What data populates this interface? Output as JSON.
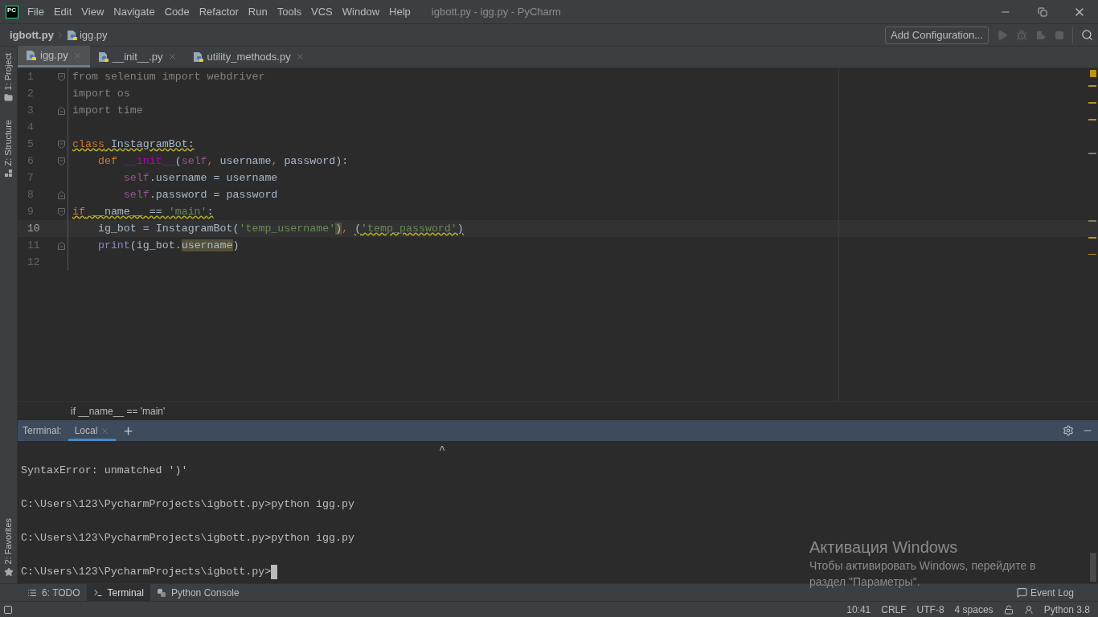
{
  "window": {
    "title": "igbott.py - igg.py - PyCharm",
    "logo": "PC"
  },
  "menu": [
    {
      "label": "File"
    },
    {
      "label": "Edit"
    },
    {
      "label": "View"
    },
    {
      "label": "Navigate"
    },
    {
      "label": "Code"
    },
    {
      "label": "Refactor"
    },
    {
      "label": "Run"
    },
    {
      "label": "Tools"
    },
    {
      "label": "VCS"
    },
    {
      "label": "Window"
    },
    {
      "label": "Help"
    }
  ],
  "breadcrumbs": [
    {
      "label": "igbott.py",
      "kind": "project"
    },
    {
      "label": "igg.py",
      "kind": "file"
    }
  ],
  "run_config": {
    "label": "Add Configuration..."
  },
  "side_tabs_top": [
    {
      "label": "1: Project",
      "kind": "folder"
    },
    {
      "label": "Z: Structure",
      "kind": "structure"
    }
  ],
  "side_tabs_bottom": [
    {
      "label": "2: Favorites",
      "kind": "star"
    }
  ],
  "editor_tabs": [
    {
      "label": "igg.py",
      "selected": true
    },
    {
      "label": "__init__.py",
      "selected": false
    },
    {
      "label": "utility_methods.py",
      "selected": false
    }
  ],
  "code_lines": [
    {
      "number": "1",
      "current": false,
      "fold_start": true,
      "fold_end": false,
      "tokens": [
        {
          "t": "from selenium import webdriver",
          "kind": "unused",
          "warning": false,
          "highlighted": false
        }
      ]
    },
    {
      "number": "2",
      "current": false,
      "fold_start": false,
      "fold_end": false,
      "tokens": [
        {
          "t": "import os",
          "kind": "unused",
          "warning": false,
          "highlighted": false
        }
      ]
    },
    {
      "number": "3",
      "current": false,
      "fold_start": false,
      "fold_end": true,
      "tokens": [
        {
          "t": "import time",
          "kind": "unused",
          "warning": false,
          "highlighted": false
        }
      ]
    },
    {
      "number": "4",
      "current": false,
      "fold_start": false,
      "fold_end": false
    },
    {
      "number": "5",
      "current": false,
      "fold_start": true,
      "fold_end": false,
      "tokens": [
        {
          "t": "class",
          "kind": "keyword",
          "warning": true,
          "highlighted": false
        },
        {
          "t": " InstagramBot:",
          "kind": "plain",
          "warning": true,
          "highlighted": false
        }
      ]
    },
    {
      "number": "6",
      "current": false,
      "fold_start": true,
      "fold_end": false,
      "tokens": [
        {
          "t": "    def ",
          "kind": "keyword",
          "warning": false,
          "highlighted": false
        },
        {
          "t": "__init__",
          "kind": "dunder",
          "warning": false,
          "highlighted": false
        },
        {
          "t": "(",
          "kind": "plain",
          "warning": false,
          "highlighted": false
        },
        {
          "t": "self",
          "kind": "self",
          "warning": false,
          "highlighted": false
        },
        {
          "t": ", ",
          "kind": "comma",
          "warning": false,
          "highlighted": false
        },
        {
          "t": "username",
          "kind": "plain",
          "warning": false,
          "highlighted": false
        },
        {
          "t": ", ",
          "kind": "comma",
          "warning": false,
          "highlighted": false
        },
        {
          "t": "password):",
          "kind": "plain",
          "warning": false,
          "highlighted": false
        }
      ]
    },
    {
      "number": "7",
      "current": false,
      "fold_start": false,
      "fold_end": false,
      "tokens": [
        {
          "t": "        self",
          "kind": "self",
          "warning": false,
          "highlighted": false
        },
        {
          "t": ".username = username",
          "kind": "plain",
          "warning": false,
          "highlighted": false
        }
      ]
    },
    {
      "number": "8",
      "current": false,
      "fold_start": false,
      "fold_end": true,
      "tokens": [
        {
          "t": "        self",
          "kind": "self",
          "warning": false,
          "highlighted": false
        },
        {
          "t": ".password = password",
          "kind": "plain",
          "warning": false,
          "highlighted": false
        }
      ]
    },
    {
      "number": "9",
      "current": false,
      "fold_start": true,
      "fold_end": false,
      "tokens": [
        {
          "t": "if",
          "kind": "keyword",
          "warning": true,
          "highlighted": false
        },
        {
          "t": " __name__ == ",
          "kind": "plain",
          "warning": true,
          "highlighted": false
        },
        {
          "t": "'main'",
          "kind": "string",
          "warning": true,
          "highlighted": false
        },
        {
          "t": ":",
          "kind": "plain",
          "warning": true,
          "highlighted": false
        }
      ]
    },
    {
      "number": "10",
      "current": true,
      "fold_start": false,
      "fold_end": false,
      "tokens": [
        {
          "t": "    ig_bot = InstagramBot(",
          "kind": "plain",
          "warning": false,
          "highlighted": false
        },
        {
          "t": "'temp_username'",
          "kind": "string",
          "warning": false,
          "highlighted": false
        },
        {
          "t": ")",
          "kind": "plain",
          "warning": false,
          "highlighted": true
        },
        {
          "t": ", ",
          "kind": "comma",
          "warning": false,
          "highlighted": false
        },
        {
          "t": "(",
          "kind": "plain",
          "warning": true,
          "highlighted": false
        },
        {
          "t": "'temp_password'",
          "kind": "string",
          "warning": true,
          "highlighted": false
        },
        {
          "t": ")",
          "kind": "plain",
          "warning": true,
          "highlighted": false
        }
      ]
    },
    {
      "number": "11",
      "current": false,
      "fold_start": false,
      "fold_end": true,
      "tokens": [
        {
          "t": "    print",
          "kind": "builtin",
          "warning": false,
          "highlighted": false
        },
        {
          "t": "(ig_bot.",
          "kind": "plain",
          "warning": false,
          "highlighted": false
        },
        {
          "t": "username",
          "kind": "plain",
          "warning": false,
          "highlighted": true
        },
        {
          "t": ")",
          "kind": "plain",
          "warning": false,
          "highlighted": false
        }
      ]
    },
    {
      "number": "12",
      "current": false,
      "fold_start": false,
      "fold_end": false
    }
  ],
  "editor_breadcrumb": "if __name__ == 'main'",
  "terminal": {
    "label": "Terminal:",
    "tabs": [
      {
        "label": "Local",
        "selected": true
      }
    ],
    "caret_line": "^",
    "lines": [
      {
        "text": "SyntaxError: unmatched ')'",
        "cursor": false
      },
      {
        "text": "C:\\Users\\123\\PycharmProjects\\igbott.py>python igg.py",
        "cursor": false
      },
      {
        "text": "C:\\Users\\123\\PycharmProjects\\igbott.py>python igg.py",
        "cursor": false
      },
      {
        "text": "C:\\Users\\123\\PycharmProjects\\igbott.py>",
        "cursor": true
      }
    ]
  },
  "windows_activation": {
    "title": "Активация Windows",
    "text": "Чтобы активировать Windows, перейдите в раздел \"Параметры\"."
  },
  "tool_windows": [
    {
      "label": "6: TODO",
      "kind": "list",
      "selected": false
    },
    {
      "label": "Terminal",
      "kind": "terminal",
      "selected": true
    },
    {
      "label": "Python Console",
      "kind": "python",
      "selected": false
    }
  ],
  "event_log": "Event Log",
  "status_bar": [
    {
      "label": "10:41",
      "kind": "text"
    },
    {
      "label": "CRLF",
      "kind": "text"
    },
    {
      "label": "UTF-8",
      "kind": "text"
    },
    {
      "label": "4 spaces",
      "kind": "text"
    },
    {
      "kind": "lock"
    },
    {
      "kind": "inspector"
    },
    {
      "label": "Python 3.8",
      "kind": "text"
    }
  ]
}
